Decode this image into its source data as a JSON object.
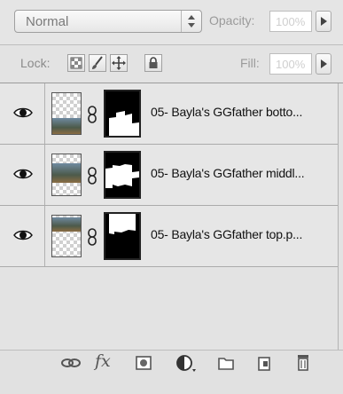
{
  "blend_mode": {
    "value": "Normal"
  },
  "opacity": {
    "label": "Opacity:",
    "value": "100%"
  },
  "lock": {
    "label": "Lock:"
  },
  "fill": {
    "label": "Fill:",
    "value": "100%"
  },
  "layers": [
    {
      "name": "05- Bayla's GGfather botto...",
      "visible": true
    },
    {
      "name": "05- Bayla's GGfather middl...",
      "visible": true
    },
    {
      "name": "05- Bayla's GGfather top.p...",
      "visible": true
    }
  ],
  "toolbar": {
    "icons": [
      "link-layers-icon",
      "fx-icon",
      "add-mask-icon",
      "adjustment-layer-icon",
      "new-group-icon",
      "new-layer-icon",
      "trash-icon"
    ],
    "fx_label": "fx"
  }
}
